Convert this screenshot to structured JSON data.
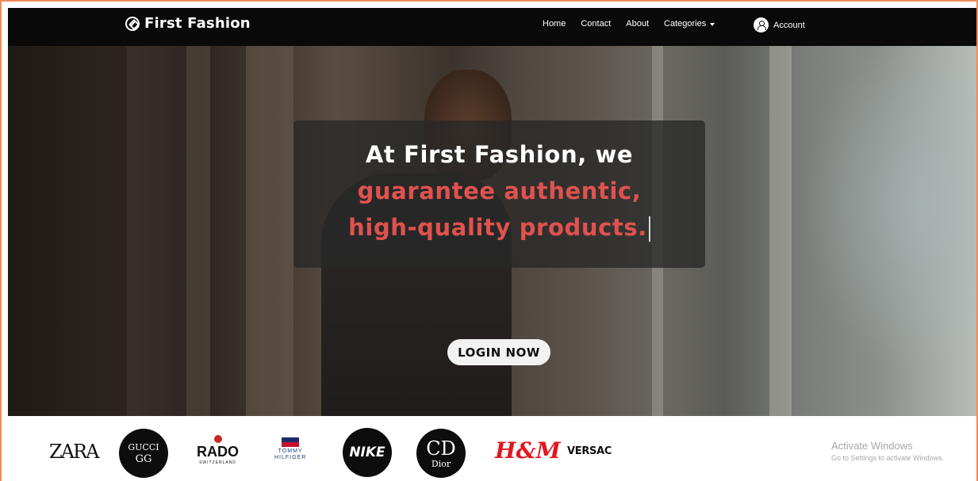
{
  "navbar": {
    "brand": "First Fashion",
    "links": {
      "home": "Home",
      "contact": "Contact",
      "about": "About",
      "categories": "Categories"
    },
    "account": "Account"
  },
  "hero": {
    "line1": "At First Fashion, we",
    "line2": "guarantee authentic,",
    "line3": "high-quality products.",
    "login_button": "LOGIN NOW",
    "accent_color": "#e0524e"
  },
  "brands": {
    "zara": "ZARA",
    "gucci": "GUCCI",
    "gucci_mark": "GG",
    "rado": "RADO",
    "rado_sub": "SWITZERLAND",
    "tommy_line1": "TOMMY",
    "tommy_line2": "HILFIGER",
    "nike": "NIKE",
    "dior_mark": "CD",
    "dior": "Dior",
    "hm": "H&M",
    "versace": "VERSAC"
  },
  "watermark": {
    "title": "Activate Windows",
    "subtitle": "Go to Settings to activate Windows."
  }
}
